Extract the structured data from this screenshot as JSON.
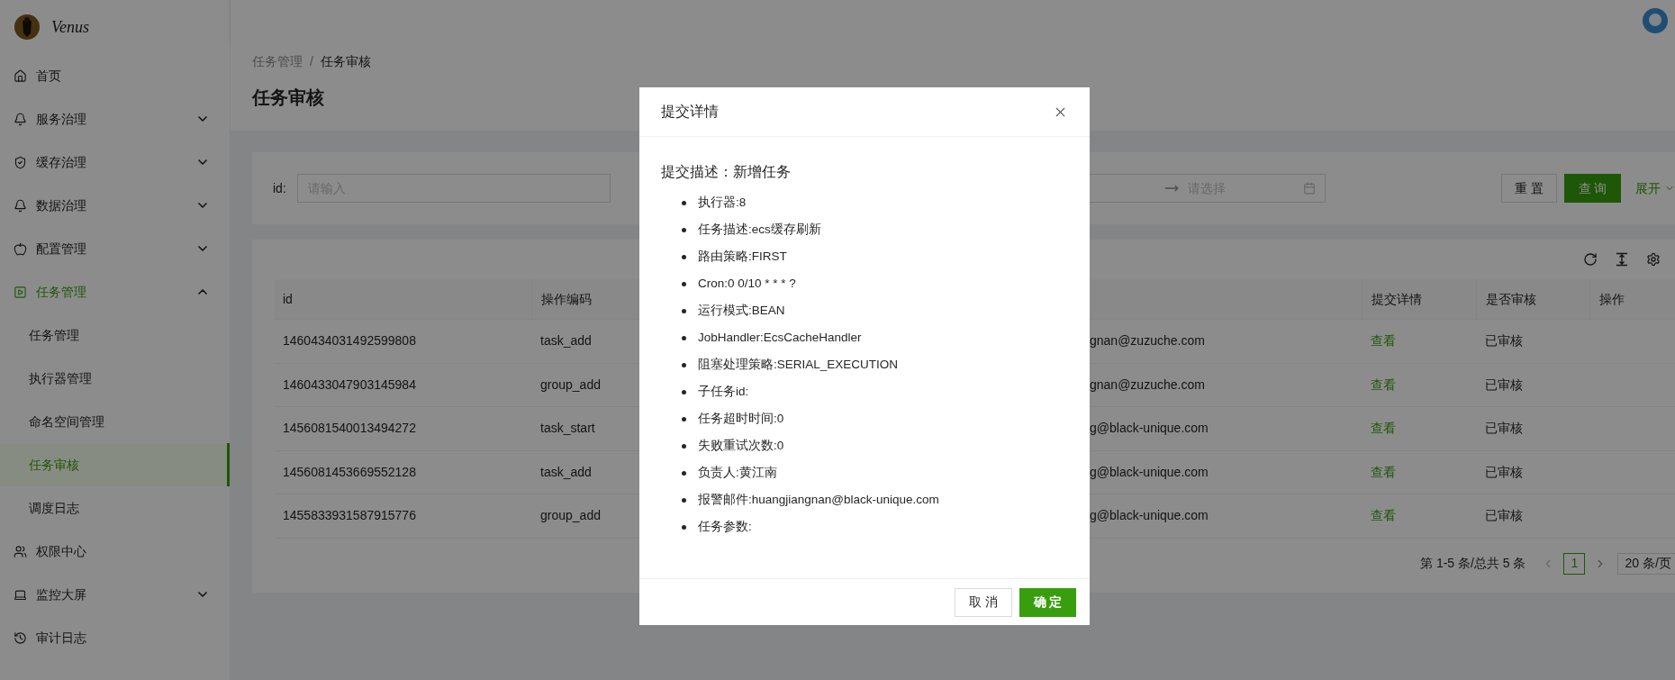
{
  "app": {
    "logo_text": "Venus"
  },
  "sidebar": {
    "items": [
      {
        "label": "首页",
        "selected": false
      },
      {
        "label": "服务治理",
        "selected": false,
        "expanded": false
      },
      {
        "label": "缓存治理",
        "selected": false,
        "expanded": false
      },
      {
        "label": "数据治理",
        "selected": false,
        "expanded": false
      },
      {
        "label": "配置管理",
        "selected": false,
        "expanded": false
      },
      {
        "label": "任务管理",
        "selected": true,
        "expanded": true,
        "children": [
          {
            "label": "任务管理",
            "selected": false
          },
          {
            "label": "执行器管理",
            "selected": false
          },
          {
            "label": "命名空间管理",
            "selected": false
          },
          {
            "label": "任务审核",
            "selected": true
          },
          {
            "label": "调度日志",
            "selected": false
          }
        ]
      },
      {
        "label": "权限中心",
        "selected": false
      },
      {
        "label": "监控大屏",
        "selected": false,
        "expanded": false
      },
      {
        "label": "审计日志",
        "selected": false
      }
    ]
  },
  "breadcrumb": [
    "任务管理",
    "任务审核"
  ],
  "breadcrumb_separator": "/",
  "page_title": "任务审核",
  "search": {
    "id_label": "id:",
    "id_placeholder": "请输入",
    "date_end_placeholder": "请选择",
    "reset": "重 置",
    "query": "查 询",
    "expand": "展开"
  },
  "table": {
    "columns": [
      {
        "label": "id"
      },
      {
        "label": "操作编码"
      },
      {
        "label": "提交详情"
      },
      {
        "label": "是否审核"
      },
      {
        "label": "操作"
      }
    ],
    "rows": [
      {
        "id": "1460434031492599808",
        "operation_code": "task_add",
        "column_3": "gnan@zuzuche.com",
        "detail": "查看",
        "status": "已审核"
      },
      {
        "id": "1460433047903145984",
        "operation_code": "group_add",
        "column_3": "gnan@zuzuche.com",
        "detail": "查看",
        "status": "已审核"
      },
      {
        "id": "1456081540013494272",
        "operation_code": "task_start",
        "column_3": "g@black-unique.com",
        "detail": "查看",
        "status": "已审核"
      },
      {
        "id": "1456081453669552128",
        "operation_code": "task_add",
        "column_3": "g@black-unique.com",
        "detail": "查看",
        "status": "已审核"
      },
      {
        "id": "1455833931587915776",
        "operation_code": "group_add",
        "column_3": "g@black-unique.com",
        "detail": "查看",
        "status": "已审核"
      }
    ]
  },
  "pagination": {
    "summary": "第 1-5 条/总共 5 条",
    "pages": [
      {
        "label": "1",
        "selected": true
      }
    ],
    "page_size": "20 条/页"
  },
  "modal": {
    "title": "提交详情",
    "description": "提交描述：新增任务",
    "items": [
      "执行器:8",
      "任务描述:ecs缓存刷新",
      "路由策略:FIRST",
      "Cron:0 0/10 * * * ?",
      "运行模式:BEAN",
      "JobHandler:EcsCacheHandler",
      "阻塞处理策略:SERIAL_EXECUTION",
      "子任务id:",
      "任务超时时间:0",
      "失败重试次数:0",
      "负责人:黄江南",
      "报警邮件:huangjiangnan@black-unique.com",
      "任务参数:"
    ],
    "cancel": "取 消",
    "ok": "确 定"
  }
}
